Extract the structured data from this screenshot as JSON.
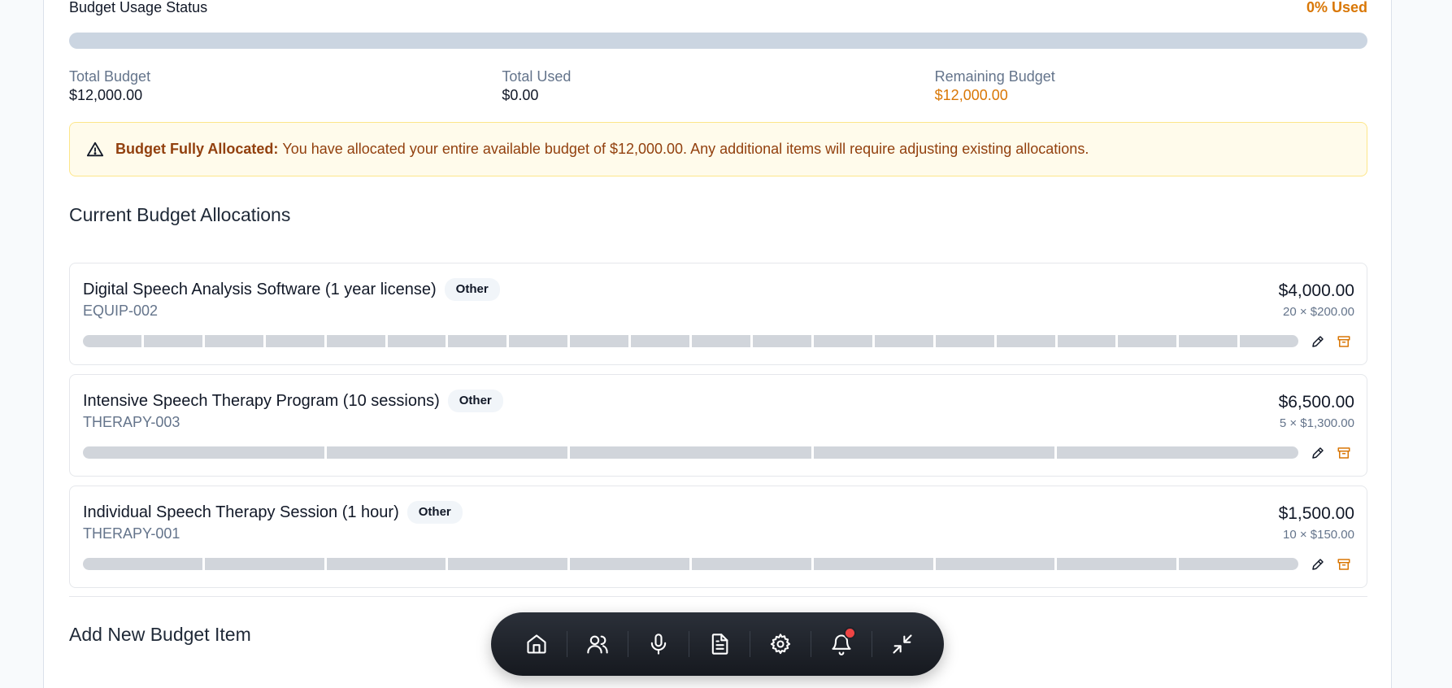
{
  "status": {
    "title": "Budget Usage Status",
    "used_label": "0% Used",
    "used_fraction": 0
  },
  "stats": {
    "total_budget_label": "Total Budget",
    "total_budget_value": "$12,000.00",
    "total_used_label": "Total Used",
    "total_used_value": "$0.00",
    "remaining_label": "Remaining Budget",
    "remaining_value": "$12,000.00"
  },
  "alert": {
    "title": "Budget Fully Allocated:",
    "message": "You have allocated your entire available budget of $12,000.00. Any additional items will require adjusting existing allocations."
  },
  "allocations_title": "Current Budget Allocations",
  "allocations": [
    {
      "name": "Digital Speech Analysis Software (1 year license)",
      "category": "Other",
      "code": "EQUIP-002",
      "amount": "$4,000.00",
      "detail": "20 × $200.00",
      "quantity": 20
    },
    {
      "name": "Intensive Speech Therapy Program (10 sessions)",
      "category": "Other",
      "code": "THERAPY-003",
      "amount": "$6,500.00",
      "detail": "5 × $1,300.00",
      "quantity": 5
    },
    {
      "name": "Individual Speech Therapy Session (1 hour)",
      "category": "Other",
      "code": "THERAPY-001",
      "amount": "$1,500.00",
      "detail": "10 × $150.00",
      "quantity": 10
    }
  ],
  "add_new_title": "Add New Budget Item",
  "dock": {
    "items": [
      "home-icon",
      "users-icon",
      "microphone-icon",
      "document-icon",
      "settings-icon",
      "bell-icon",
      "minimize-icon"
    ],
    "notification_dot": true
  },
  "colors": {
    "accent_orange": "#d97706",
    "alert_bg": "#fffbeb",
    "alert_text": "#92400e",
    "notification": "#ef4444"
  }
}
